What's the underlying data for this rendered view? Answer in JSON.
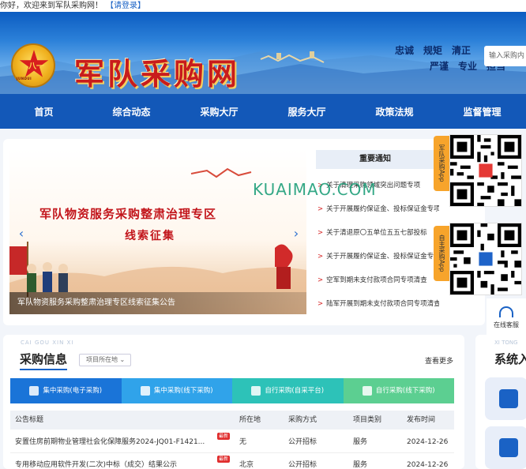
{
  "topbar": {
    "welcome": "你好，欢迎来到军队采购网！",
    "login": "【请登录】"
  },
  "header": {
    "site_name": "军队采购网",
    "emblem_text": "八一",
    "emblem_ribbon": "JUNDUI",
    "motto_row1": [
      "忠诚",
      "规矩",
      "清正"
    ],
    "motto_row2": [
      "严谨",
      "专业",
      "担当"
    ],
    "search_placeholder": "输入采购内"
  },
  "nav": [
    "首页",
    "综合动态",
    "采购大厅",
    "服务大厅",
    "政策法规",
    "监督管理"
  ],
  "carousel": {
    "line1": "军队物资服务采购整肃治理专区",
    "line2": "线索征集",
    "caption": "军队物资服务采购整肃治理专区线索征集公告",
    "prev": "‹",
    "next": "›"
  },
  "notices": {
    "title": "重要通知",
    "items": [
      "关于清理采购领域突出问题专项",
      "关于开展履约保证金、投标保证金专项清理公告",
      "关于清退原〇五单位五五七部投标",
      "关于开展履约保证金、投标保证金专",
      "空军到期未支付款项合同专项清查",
      "陆军开展到期未支付款项合同专项清查公告"
    ]
  },
  "qr": [
    {
      "label": "军队采购App"
    },
    {
      "label": "自主采购App"
    }
  ],
  "watermark": "KUAIMAO.COM",
  "service": {
    "label": "在线客服"
  },
  "procurement": {
    "title_en": "CAI GOU XIN XI",
    "title": "采购信息",
    "filter": "项目所在地",
    "more": "查看更多",
    "tabs": [
      {
        "label": "集中采购(电子采购)",
        "color": "#1a74d8"
      },
      {
        "label": "集中采购(线下采购)",
        "color": "#30a3ea"
      },
      {
        "label": "自行采购(自采平台)",
        "color": "#2dc2b8"
      },
      {
        "label": "自行采购(线下采购)",
        "color": "#5ccf91"
      }
    ],
    "columns": [
      "公告标题",
      "所在地",
      "采购方式",
      "项目类别",
      "发布时间"
    ],
    "rows": [
      {
        "title": "安置住房前期物业管理社会化保障服务2024-JQ01-F1421...",
        "badge": "最新",
        "location": "无",
        "method": "公开招标",
        "category": "服务",
        "date": "2024-12-26"
      },
      {
        "title": "专用移动应用软件开发(二次)中标（成交）结果公示",
        "badge": "最新",
        "location": "北京",
        "method": "公开招标",
        "category": "服务",
        "date": "2024-12-26"
      }
    ]
  },
  "system": {
    "title_en": "XI TONG",
    "title": "系统入"
  }
}
